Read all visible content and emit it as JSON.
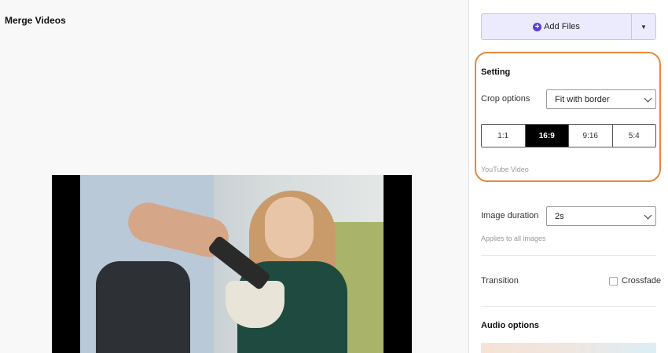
{
  "main": {
    "title": "Merge Videos"
  },
  "sidebar": {
    "add_files_label": "Add Files",
    "setting": {
      "title": "Setting",
      "crop_label": "Crop options",
      "crop_value": "Fit with border",
      "ratios": [
        "1:1",
        "16:9",
        "9:16",
        "5:4"
      ],
      "active_ratio": "16:9",
      "ratio_hint": "YouTube Video"
    },
    "image_duration": {
      "label": "Image duration",
      "value": "2s",
      "hint": "Applies to all images"
    },
    "transition": {
      "label": "Transition",
      "option_label": "Crossfade",
      "checked": false
    },
    "audio": {
      "title": "Audio options"
    }
  },
  "colors": {
    "accent": "#5b3fd6",
    "highlight": "#e8883a",
    "active_ratio_bg": "#000000"
  }
}
